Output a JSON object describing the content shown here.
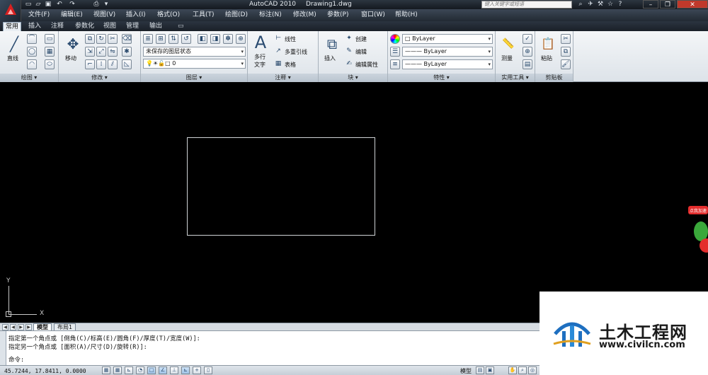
{
  "app": {
    "name": "AutoCAD 2010",
    "document": "Drawing1.dwg",
    "search_placeholder": "键入关键字或短语"
  },
  "menubar": [
    "文件(F)",
    "编辑(E)",
    "视图(V)",
    "插入(I)",
    "格式(O)",
    "工具(T)",
    "绘图(D)",
    "标注(N)",
    "修改(M)",
    "参数(P)",
    "窗口(W)",
    "帮助(H)"
  ],
  "ribbon_tabs": [
    "常用",
    "插入",
    "注释",
    "参数化",
    "视图",
    "管理",
    "输出"
  ],
  "panels": {
    "draw": {
      "title": "绘图",
      "line": "直线"
    },
    "modify": {
      "title": "修改",
      "move": "移动"
    },
    "layers": {
      "title": "图层",
      "state": "未保存的图层状态",
      "current_layer": "0"
    },
    "annotation": {
      "title": "注释",
      "mtext_line1": "多行",
      "mtext_line2": "文字",
      "linear": "线性",
      "mleader": "多重引线",
      "table": "表格"
    },
    "block": {
      "title": "块",
      "insert": "插入",
      "create": "创建",
      "edit": "编辑",
      "edit_attr": "编辑属性"
    },
    "properties": {
      "title": "特性",
      "color": "ByLayer",
      "linetype": "ByLayer",
      "lineweight": "ByLayer"
    },
    "utilities": {
      "title": "实用工具",
      "measure": "测量"
    },
    "clipboard": {
      "title": "剪贴板",
      "paste": "粘贴"
    }
  },
  "ucs": {
    "x_label": "X",
    "y_label": "Y"
  },
  "layout_tabs": [
    "模型",
    "布局1"
  ],
  "command_lines": [
    "指定第一个角点或 [倒角(C)/标高(E)/圆角(F)/厚度(T)/宽度(W)]:",
    "指定另一个角点或 [面积(A)/尺寸(D)/旋转(R)]:",
    "命令:"
  ],
  "status": {
    "coordinates": "45.7244,  17.8411, 0.0000",
    "space": "模型"
  },
  "watermark": {
    "title": "土木工程网",
    "url": "www.civilcn.com"
  },
  "ad": {
    "text": "点我加速"
  }
}
